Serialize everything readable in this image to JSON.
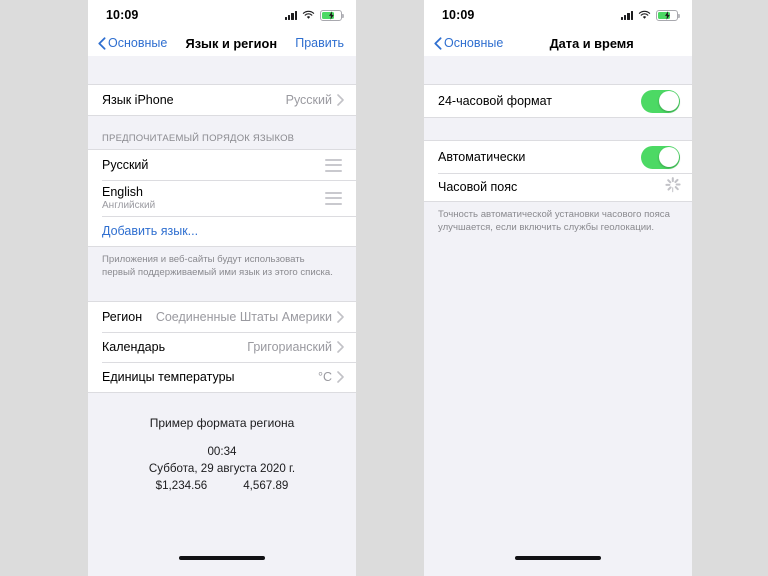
{
  "background_color": "#dcdcdc",
  "accent_color": "#2f6fd0",
  "toggle_on_color": "#4cd964",
  "screens": [
    {
      "id": "language-region",
      "status_bar": {
        "time": "10:09",
        "icons": [
          "cellular-signal-icon",
          "wifi-icon",
          "battery-charging-icon"
        ]
      },
      "nav": {
        "back_label": "Основные",
        "title": "Язык и регион",
        "action_label": "Править"
      },
      "iphone_language": {
        "label": "Язык iPhone",
        "value": "Русский"
      },
      "preferred_order": {
        "header": "ПРЕДПОЧИТАЕМЫЙ ПОРЯДОК ЯЗЫКОВ",
        "items": [
          {
            "name": "Русский",
            "subtitle": ""
          },
          {
            "name": "English",
            "subtitle": "Английский"
          }
        ],
        "add_language_label": "Добавить язык...",
        "footnote": "Приложения и веб-сайты будут использовать первый поддерживаемый ими язык из этого списка."
      },
      "region_group": [
        {
          "label": "Регион",
          "value": "Соединенные Штаты Америки"
        },
        {
          "label": "Календарь",
          "value": "Григорианский"
        },
        {
          "label": "Единицы температуры",
          "value": "°C"
        }
      ],
      "sample": {
        "title": "Пример формата региона",
        "time": "00:34",
        "date": "Суббота, 29 августа 2020 г.",
        "currency": "$1,234.56",
        "number": "4,567.89"
      }
    },
    {
      "id": "date-time",
      "status_bar": {
        "time": "10:09",
        "icons": [
          "cellular-signal-icon",
          "wifi-icon",
          "battery-charging-icon"
        ]
      },
      "nav": {
        "back_label": "Основные",
        "title": "Дата и время",
        "action_label": ""
      },
      "hour24": {
        "label": "24-часовой формат",
        "state": "on"
      },
      "automatic": {
        "label": "Автоматически",
        "state": "on"
      },
      "timezone": {
        "label": "Часовой пояс",
        "status": "loading"
      },
      "footnote": "Точность автоматической установки часового пояса улучшается, если включить службы геолокации."
    }
  ]
}
